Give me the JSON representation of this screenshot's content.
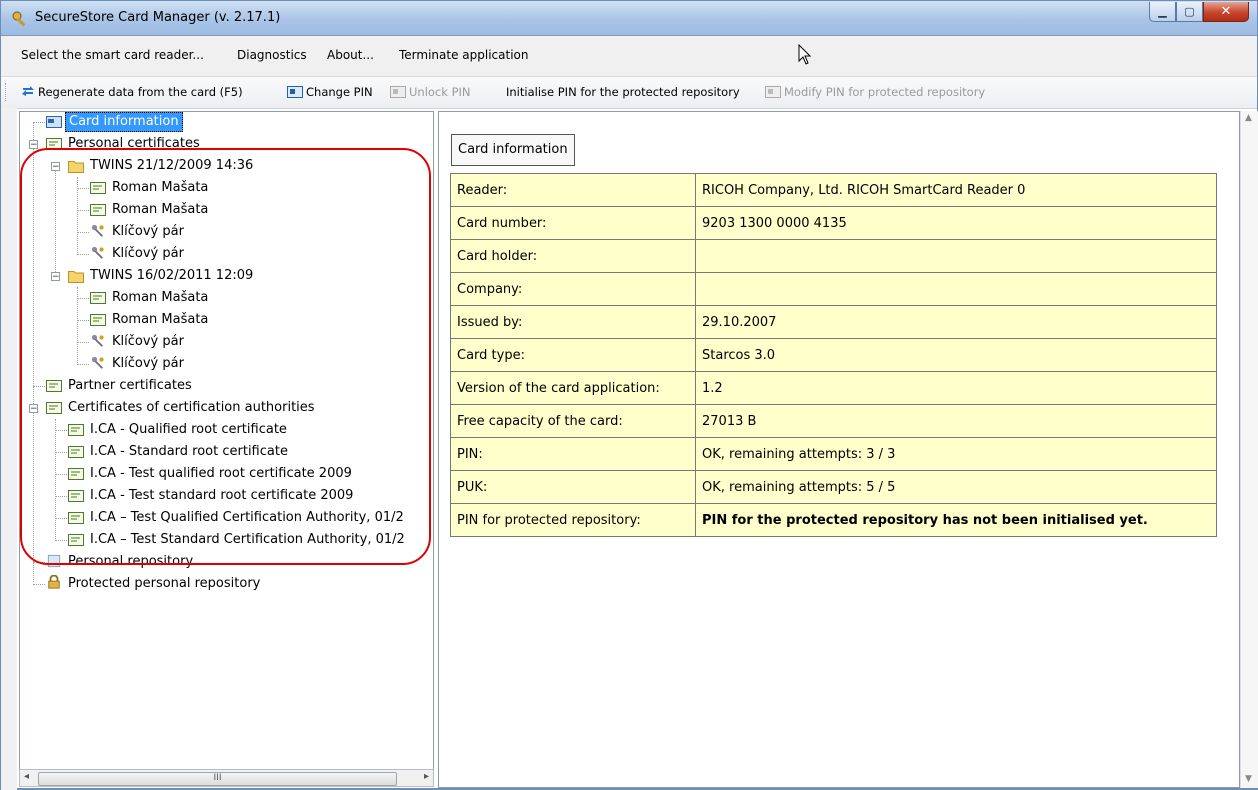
{
  "window": {
    "title": "SecureStore Card Manager (v. 2.17.1)"
  },
  "menu": {
    "select_reader": "Select the smart card reader...",
    "diagnostics": "Diagnostics",
    "about": "About...",
    "terminate": "Terminate application"
  },
  "toolbar": {
    "regenerate": "Regenerate data from the card (F5)",
    "change_pin": "Change PIN",
    "unlock_pin": "Unlock PIN",
    "init_pin": "Initialise PIN for the protected repository",
    "modify_pin": "Modify PIN for protected repository"
  },
  "tree": {
    "card_information": "Card information",
    "personal_certificates": "Personal certificates",
    "twins1": "TWINS 21/12/2009 14:36",
    "roman1": "Roman Mašata",
    "roman2": "Roman Mašata",
    "key1": "Klíčový pár",
    "key2": "Klíčový pár",
    "twins2": "TWINS 16/02/2011 12:09",
    "roman3": "Roman Mašata",
    "roman4": "Roman Mašata",
    "key3": "Klíčový pár",
    "key4": "Klíčový pár",
    "partner_certificates": "Partner certificates",
    "ca_certificates": "Certificates of certification authorities",
    "ca1": "I.CA - Qualified root certificate",
    "ca2": "I.CA - Standard root certificate",
    "ca3": "I.CA - Test qualified root certificate 2009",
    "ca4": "I.CA - Test standard root certificate 2009",
    "ca5": "I.CA – Test Qualified Certification Authority, 01/2",
    "ca6": "I.CA – Test Standard Certification Authority, 01/2",
    "personal_repository": "Personal repository",
    "protected_repository": "Protected personal repository"
  },
  "hscroll": {
    "thumb_glyph": "III"
  },
  "panel": {
    "heading": "Card information",
    "rows": [
      {
        "key": "Reader:",
        "value": "RICOH Company, Ltd. RICOH SmartCard Reader 0"
      },
      {
        "key": "Card number:",
        "value": "9203 1300 0000 4135"
      },
      {
        "key": "Card holder:",
        "value": ""
      },
      {
        "key": "Company:",
        "value": ""
      },
      {
        "key": "Issued by:",
        "value": "29.10.2007"
      },
      {
        "key": "Card type:",
        "value": "Starcos 3.0"
      },
      {
        "key": "Version of the card application:",
        "value": "1.2"
      },
      {
        "key": "Free capacity of the card:",
        "value": "27013 B"
      },
      {
        "key": "PIN:",
        "value": "OK, remaining attempts: 3 / 3"
      },
      {
        "key": "PUK:",
        "value": "OK, remaining attempts: 5 / 5"
      },
      {
        "key": "PIN for protected repository:",
        "value": "PIN for the protected repository has not been initialised yet."
      }
    ]
  },
  "colors": {
    "selection": "#3399ff",
    "table_bg": "#ffffcc",
    "annotation": "#e00000"
  }
}
